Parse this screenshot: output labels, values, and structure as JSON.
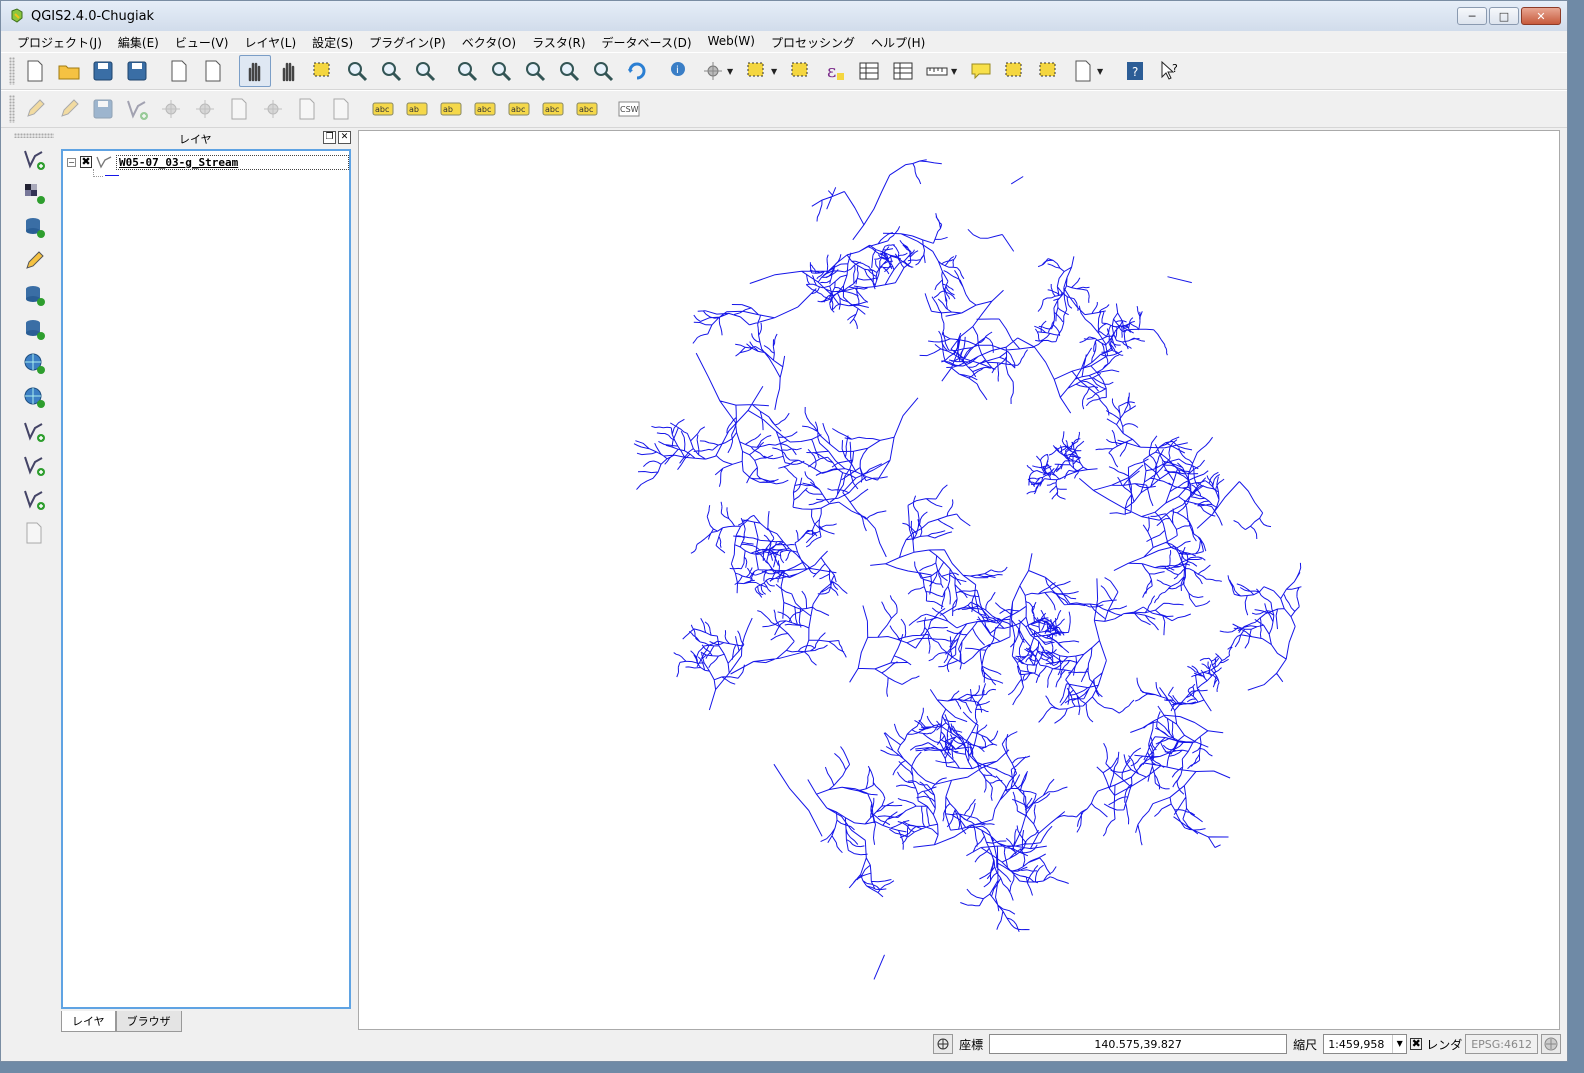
{
  "window": {
    "title": "QGIS2.4.0-Chugiak",
    "minimize_icon": "minimize-icon",
    "maximize_icon": "maximize-icon",
    "close_icon": "close-icon"
  },
  "menu": [
    "プロジェクト(J)",
    "編集(E)",
    "ビュー(V)",
    "レイヤ(L)",
    "設定(S)",
    "プラグイン(P)",
    "ベクタ(O)",
    "ラスタ(R)",
    "データベース(D)",
    "Web(W)",
    "プロセッシング",
    "ヘルプ(H)"
  ],
  "toolbar1": [
    {
      "icon": "new-project-icon"
    },
    {
      "icon": "open-project-icon"
    },
    {
      "icon": "save-project-icon"
    },
    {
      "icon": "save-as-icon"
    },
    {
      "icon": "new-print-composer-icon"
    },
    {
      "icon": "composer-manager-icon"
    },
    {
      "icon": "touch-icon"
    },
    {
      "icon": "pan-icon"
    },
    {
      "icon": "pan-to-selection-icon"
    },
    {
      "icon": "zoom-in-icon"
    },
    {
      "icon": "zoom-out-icon"
    },
    {
      "icon": "zoom-actual-icon"
    },
    {
      "icon": "zoom-full-icon"
    },
    {
      "icon": "zoom-selection-icon"
    },
    {
      "icon": "zoom-layer-icon"
    },
    {
      "icon": "zoom-last-icon"
    },
    {
      "icon": "zoom-next-icon"
    },
    {
      "icon": "refresh-icon"
    },
    {
      "icon": "identify-icon"
    },
    {
      "icon": "action-icon"
    },
    {
      "icon": "select-icon"
    },
    {
      "icon": "deselect-icon"
    },
    {
      "icon": "field-calculator-icon"
    },
    {
      "icon": "attribute-table-icon"
    },
    {
      "icon": "statistics-icon"
    },
    {
      "icon": "measure-icon"
    },
    {
      "icon": "map-tips-icon"
    },
    {
      "icon": "new-bookmark-icon"
    },
    {
      "icon": "show-bookmarks-icon"
    },
    {
      "icon": "text-annotation-icon"
    },
    {
      "icon": "help-icon"
    },
    {
      "icon": "whats-this-icon"
    }
  ],
  "toolbar2": [
    {
      "icon": "toggle-editing-icon"
    },
    {
      "icon": "current-edits-icon"
    },
    {
      "icon": "save-edits-icon"
    },
    {
      "icon": "add-feature-icon"
    },
    {
      "icon": "move-feature-icon"
    },
    {
      "icon": "node-tool-icon"
    },
    {
      "icon": "delete-selected-icon"
    },
    {
      "icon": "cut-features-icon"
    },
    {
      "icon": "copy-features-icon"
    },
    {
      "icon": "paste-features-icon"
    },
    {
      "icon": "labeling-icon",
      "text": "abc"
    },
    {
      "icon": "layer-labeling-icon",
      "text": "ab"
    },
    {
      "icon": "pin-labels-icon",
      "text": "ab"
    },
    {
      "icon": "show-hide-labels-icon",
      "text": "abc"
    },
    {
      "icon": "move-label-icon",
      "text": "abc"
    },
    {
      "icon": "rotate-label-icon",
      "text": "abc"
    },
    {
      "icon": "change-label-icon",
      "text": "abc"
    },
    {
      "icon": "csw-icon",
      "text": "CSW"
    }
  ],
  "left_toolbar": [
    "add-vector-layer-icon",
    "add-raster-layer-icon",
    "add-postgis-layer-icon",
    "add-spatialite-layer-icon",
    "add-mssql-layer-icon",
    "add-oracle-layer-icon",
    "add-wms-layer-icon",
    "add-wcs-layer-icon",
    "add-wfs-layer-icon",
    "add-delimited-text-icon",
    "new-shapefile-icon",
    "add-virtual-layer-icon"
  ],
  "layers_panel": {
    "title": "レイヤ",
    "layers": [
      {
        "name": "W05-07_03-g_Stream",
        "visible": true,
        "color": "#1515e8"
      }
    ],
    "tabs": [
      "レイヤ",
      "ブラウザ"
    ]
  },
  "statusbar": {
    "coord_label": "座標",
    "coord_value": "140.575,39.827",
    "scale_label": "縮尺",
    "scale_value": "1:459,958",
    "render_label": "レンダ",
    "crs_value": "EPSG:4612"
  },
  "map": {
    "stream_color": "#1515e8",
    "background": "#ffffff"
  }
}
